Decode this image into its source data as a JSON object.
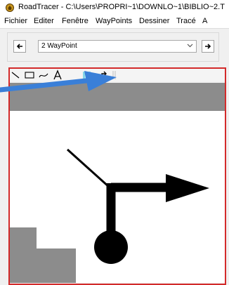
{
  "window": {
    "title": "RoadTracer - C:\\Users\\PROPRI~1\\DOWNLO~1\\BIBLIO~2.T",
    "app_icon": "roadtracer-logo-icon"
  },
  "menu": [
    "Fichier",
    "Editer",
    "Fenêtre",
    "WayPoints",
    "Dessiner",
    "Tracé",
    "A"
  ],
  "navigator": {
    "prev_icon": "arrow-left-icon",
    "next_icon": "arrow-right-icon",
    "selected_waypoint": "2 WayPoint",
    "dropdown_icon": "chevron-down-icon"
  },
  "toolbar": {
    "tools": [
      "line-tool-icon",
      "rectangle-tool-icon",
      "curve-tool-icon",
      "text-tool-icon",
      "fill-tool-icon",
      "turn-arrow-tool-icon"
    ]
  },
  "annotation": {
    "pointer": "blue-arrow-annotation",
    "color": "#3a7fd8"
  },
  "colors": {
    "frame_border": "#d32a2a",
    "map_gray": "#8c8c8c",
    "route_black": "#000000"
  }
}
